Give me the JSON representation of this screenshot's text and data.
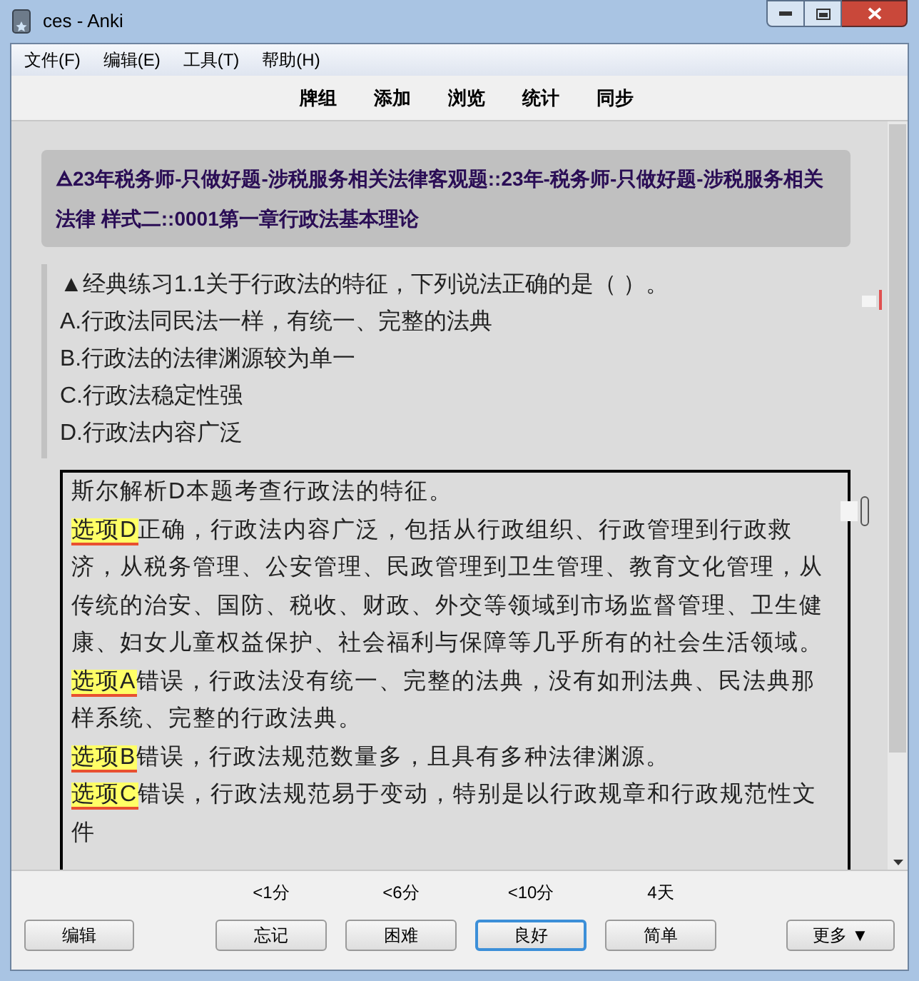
{
  "window": {
    "title": "ces - Anki"
  },
  "menu": [
    "文件(F)",
    "编辑(E)",
    "工具(T)",
    "帮助(H)"
  ],
  "toolbar": [
    "牌组",
    "添加",
    "浏览",
    "统计",
    "同步"
  ],
  "deck_path": "🜁23年税务师-只做好题-涉税服务相关法律客观题::23年-税务师-只做好题-涉税服务相关法律 样式二::0001第一章行政法基本理论",
  "question": [
    "▲经典练习1.1关于行政法的特征，下列说法正确的是（ ）。",
    "A.行政法同民法一样，有统一、完整的法典",
    "B.行政法的法律渊源较为单一",
    "C.行政法稳定性强",
    "D.行政法内容广泛"
  ],
  "answer": [
    {
      "text": "斯尔解析D本题考查行政法的特征。"
    },
    {
      "tag": "选项D",
      "text": "正确，行政法内容广泛，包括从行政组织、行政管理到行政救济，从税务管理、公安管理、民政管理到卫生管理、教育文化管理，从传统的治安、国防、税收、财政、外交等领域到市场监督管理、卫生健康、妇女儿童权益保护、社会福利与保障等几乎所有的社会生活领域。"
    },
    {
      "tag": "选项A",
      "text": "错误，行政法没有统一、完整的法典，没有如刑法典、民法典那样系统、完整的行政法典。"
    },
    {
      "tag": "选项B",
      "text": "错误，行政法规范数量多，且具有多种法律渊源。"
    },
    {
      "tag": "选项C",
      "text": "错误，行政法规范易于变动，特别是以行政规章和行政规范性文件"
    }
  ],
  "bottom": {
    "edit": "编辑",
    "answers": [
      {
        "interval": "<1分",
        "label": "忘记",
        "selected": false
      },
      {
        "interval": "<6分",
        "label": "困难",
        "selected": false
      },
      {
        "interval": "<10分",
        "label": "良好",
        "selected": true
      },
      {
        "interval": "4天",
        "label": "简单",
        "selected": false
      }
    ],
    "more": "更多 ▼"
  }
}
